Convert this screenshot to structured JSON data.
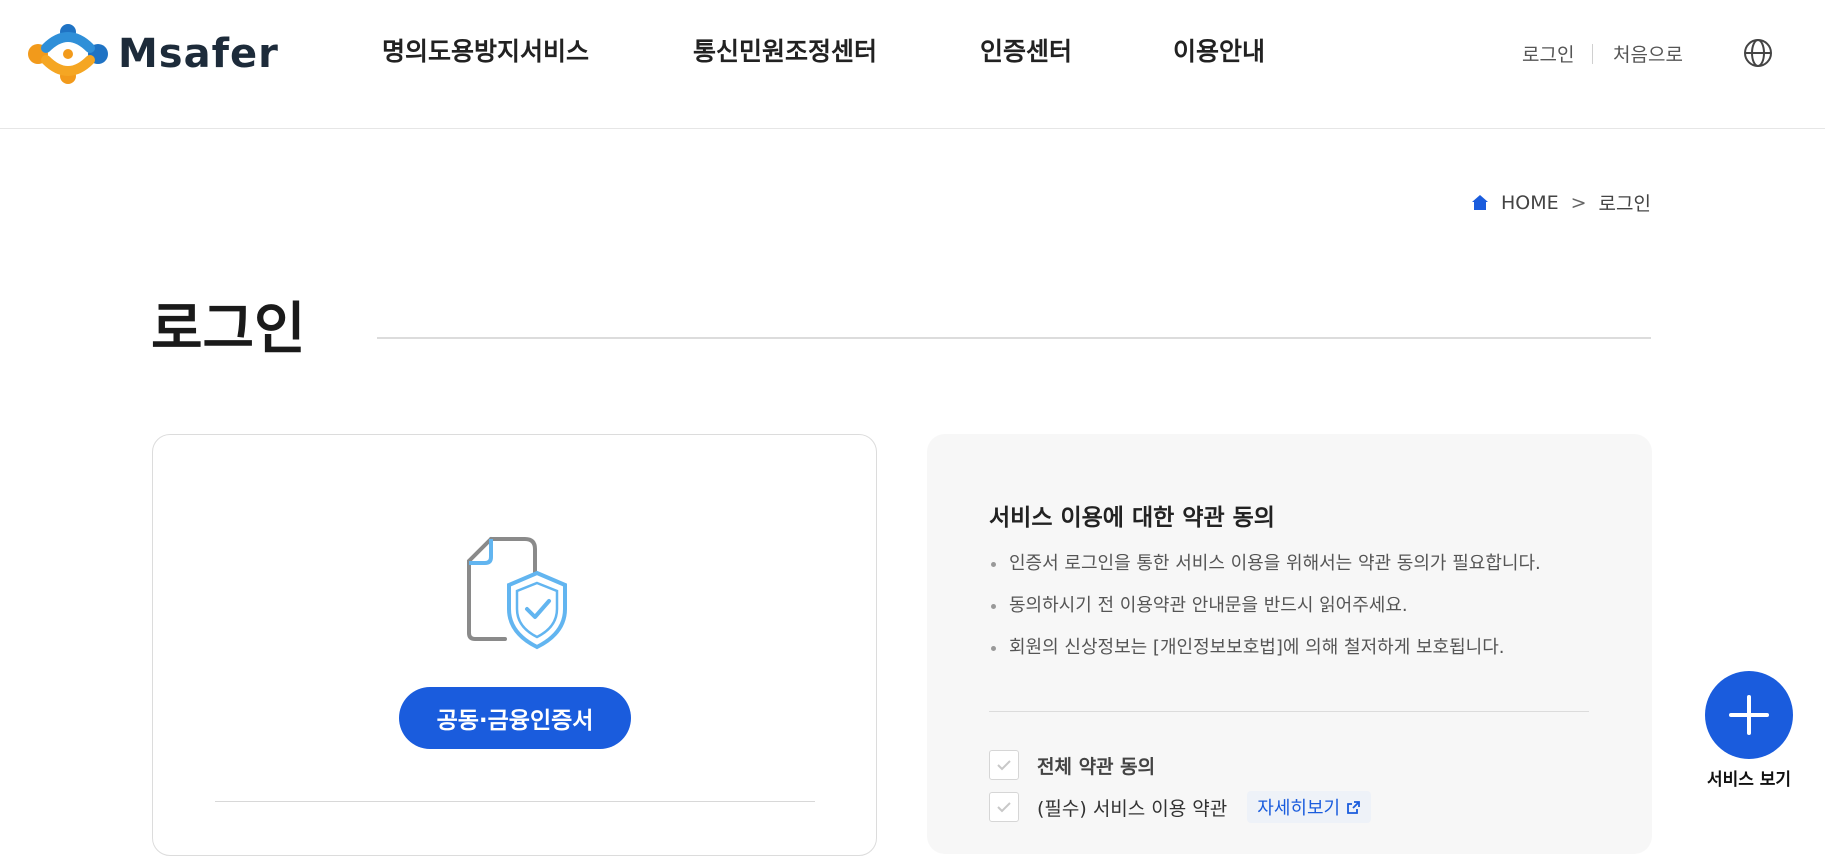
{
  "header": {
    "logo_text": "Msafer",
    "nav": [
      {
        "label": "명의도용방지서비스"
      },
      {
        "label": "통신민원조정센터"
      },
      {
        "label": "인증센터"
      },
      {
        "label": "이용안내"
      }
    ],
    "util": {
      "login": "로그인",
      "home": "처음으로"
    },
    "icons": {
      "globe": "globe-icon"
    }
  },
  "breadcrumb": {
    "home": "HOME",
    "separator": ">",
    "current": "로그인"
  },
  "page": {
    "title": "로그인"
  },
  "left_card": {
    "cert_button": "공동·금융인증서"
  },
  "terms": {
    "title": "서비스 이용에 대한 약관 동의",
    "notices": [
      "인증서 로그인을 통한 서비스 이용을 위해서는 약관 동의가 필요합니다.",
      "동의하시기 전 이용약관 안내문을 반드시 읽어주세요.",
      "회원의 신상정보는 [개인정보보호법]에 의해 철저하게 보호됩니다."
    ],
    "all_agree": "전체 약관 동의",
    "items": [
      {
        "label": "(필수) 서비스 이용 약관",
        "detail": "자세히보기"
      }
    ]
  },
  "fab": {
    "label": "서비스 보기"
  },
  "colors": {
    "primary": "#1a5cdd",
    "accent_light": "#62b5f0",
    "panel_bg": "#f7f7f7"
  }
}
